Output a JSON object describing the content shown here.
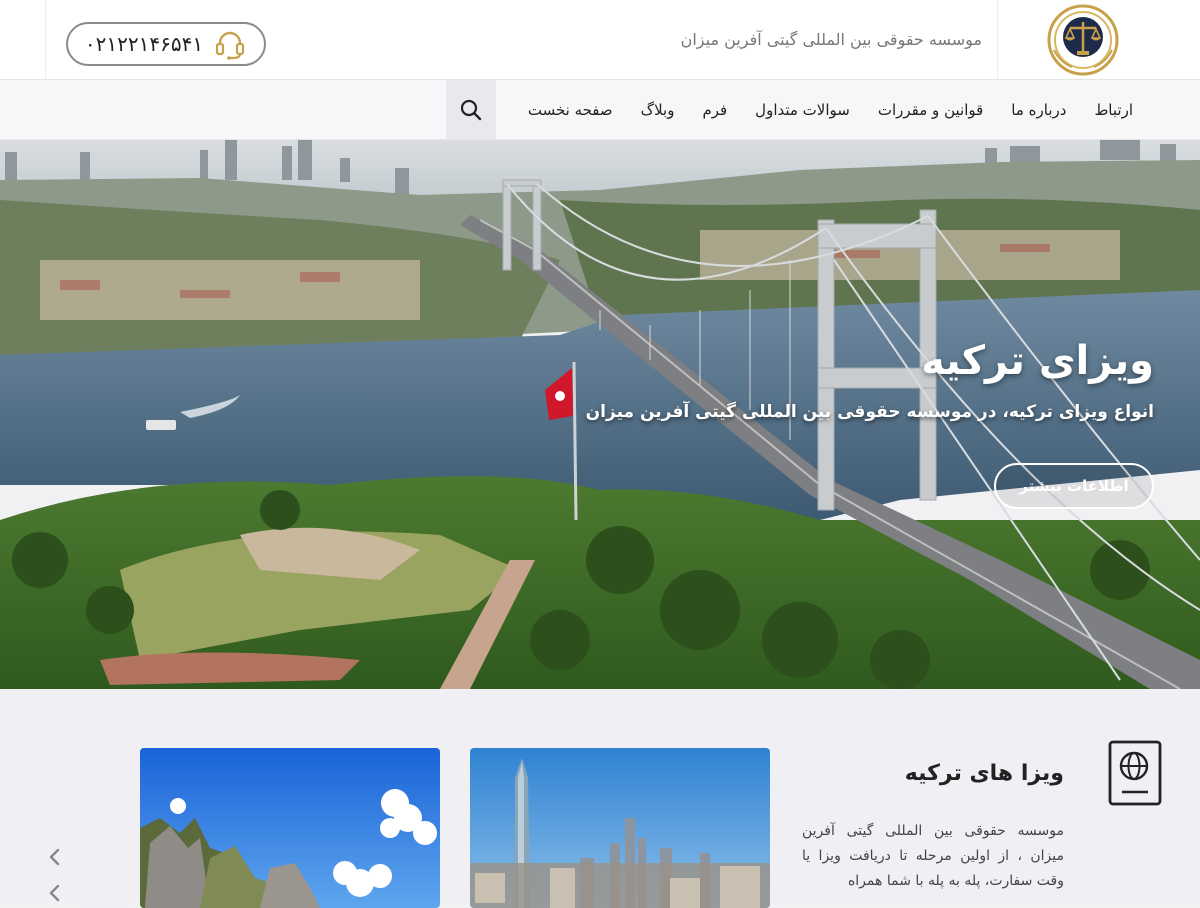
{
  "header": {
    "org_name": "موسسه حقوقی بین المللی گیتی آفرین میزان",
    "phone": "۰۲۱۲۲۱۴۶۵۴۱",
    "logo_alt": "logo"
  },
  "nav": {
    "items": [
      {
        "label": "صفحه نخست"
      },
      {
        "label": "وبلاگ"
      },
      {
        "label": "فرم"
      },
      {
        "label": "سوالات متداول"
      },
      {
        "label": "قوانین و مقررات"
      },
      {
        "label": "درباره ما"
      },
      {
        "label": "ارتباط"
      }
    ],
    "search_icon": "search-icon"
  },
  "hero": {
    "title": "ویزای ترکیه",
    "subtitle": "انواع ویزای ترکیه، در موسسه حقوقی بین المللی گیتی آفرین میزان",
    "button_label": "اطلاعات بیشتر"
  },
  "section": {
    "title": "ویزا های ترکیه",
    "text": "موسسه حقوقی بین المللی گیتی آفرین میزان ، از اولین مرحله تا دریافت ویزا یا وقت سفارت، پله به پله با شما همراه",
    "icon": "passport-icon"
  },
  "colors": {
    "accent_gold": "#c8a24a",
    "nav_bg": "#f7f7f9",
    "section_bg": "#f0eff4"
  }
}
